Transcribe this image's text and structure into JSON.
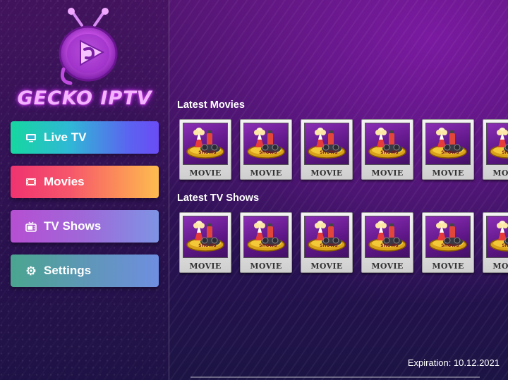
{
  "app": {
    "brand": "GECKO IPTV"
  },
  "sidebar": {
    "items": [
      {
        "label": "Live TV",
        "icon": "tv-screen-icon"
      },
      {
        "label": "Movies",
        "icon": "film-icon"
      },
      {
        "label": "TV Shows",
        "icon": "retro-tv-icon"
      },
      {
        "label": "Settings",
        "icon": "gear-icon"
      }
    ]
  },
  "sections": {
    "movies": {
      "title": "Latest Movies",
      "items": [
        "MOVIE",
        "MOVIE",
        "MOVIE",
        "MOVIE",
        "MOVIE",
        "MOVIE"
      ]
    },
    "tv_shows": {
      "title": "Latest TV Shows",
      "items": [
        "MOVIE",
        "MOVIE",
        "MOVIE",
        "MOVIE",
        "MOVIE",
        "MOVIE"
      ]
    }
  },
  "poster_badge": "SHOWS",
  "footer": {
    "expiration": "Expiration: 10.12.2021"
  },
  "colors": {
    "brand_glow": "#e14bff",
    "live_tv_gradient": [
      "#16d7a0",
      "#6a4cf5"
    ],
    "movies_gradient": [
      "#ef3370",
      "#fdbc4f"
    ],
    "tv_shows_gradient": [
      "#b64fd2",
      "#7e94e4"
    ],
    "settings_gradient": [
      "#4aa58f",
      "#6f8ee0"
    ]
  }
}
